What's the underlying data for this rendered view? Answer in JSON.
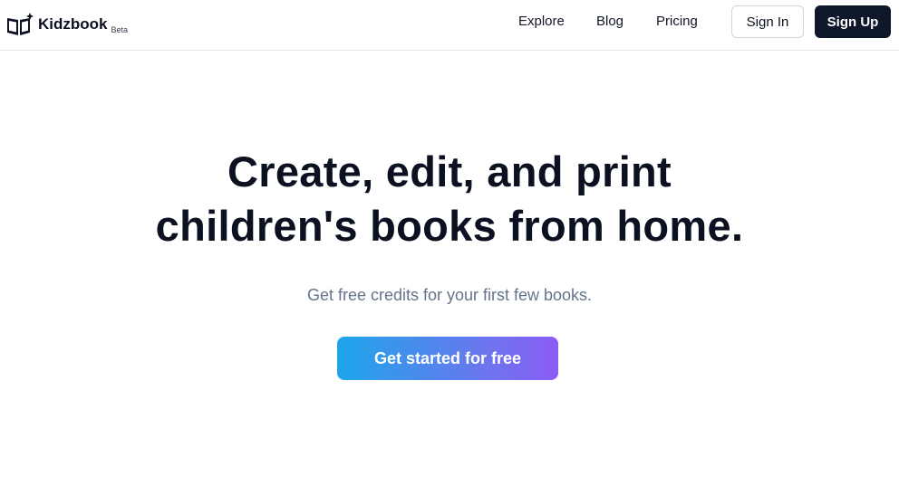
{
  "brand": {
    "name": "Kidzbook",
    "badge": "Beta",
    "icon": "open-book-sparkle-icon"
  },
  "nav": {
    "links": [
      {
        "label": "Explore"
      },
      {
        "label": "Blog"
      },
      {
        "label": "Pricing"
      }
    ],
    "sign_in": "Sign In",
    "sign_up": "Sign Up"
  },
  "hero": {
    "title_line1": "Create, edit, and print",
    "title_line2": "children's books from home.",
    "subtitle": "Get free credits for your first few books.",
    "cta": "Get started for free"
  },
  "colors": {
    "text": "#0b1120",
    "muted": "#64748b",
    "primary_dark": "#0f172a",
    "gradient_start": "#1ea6ea",
    "gradient_end": "#8b5cf6",
    "border": "#e5e7eb"
  }
}
